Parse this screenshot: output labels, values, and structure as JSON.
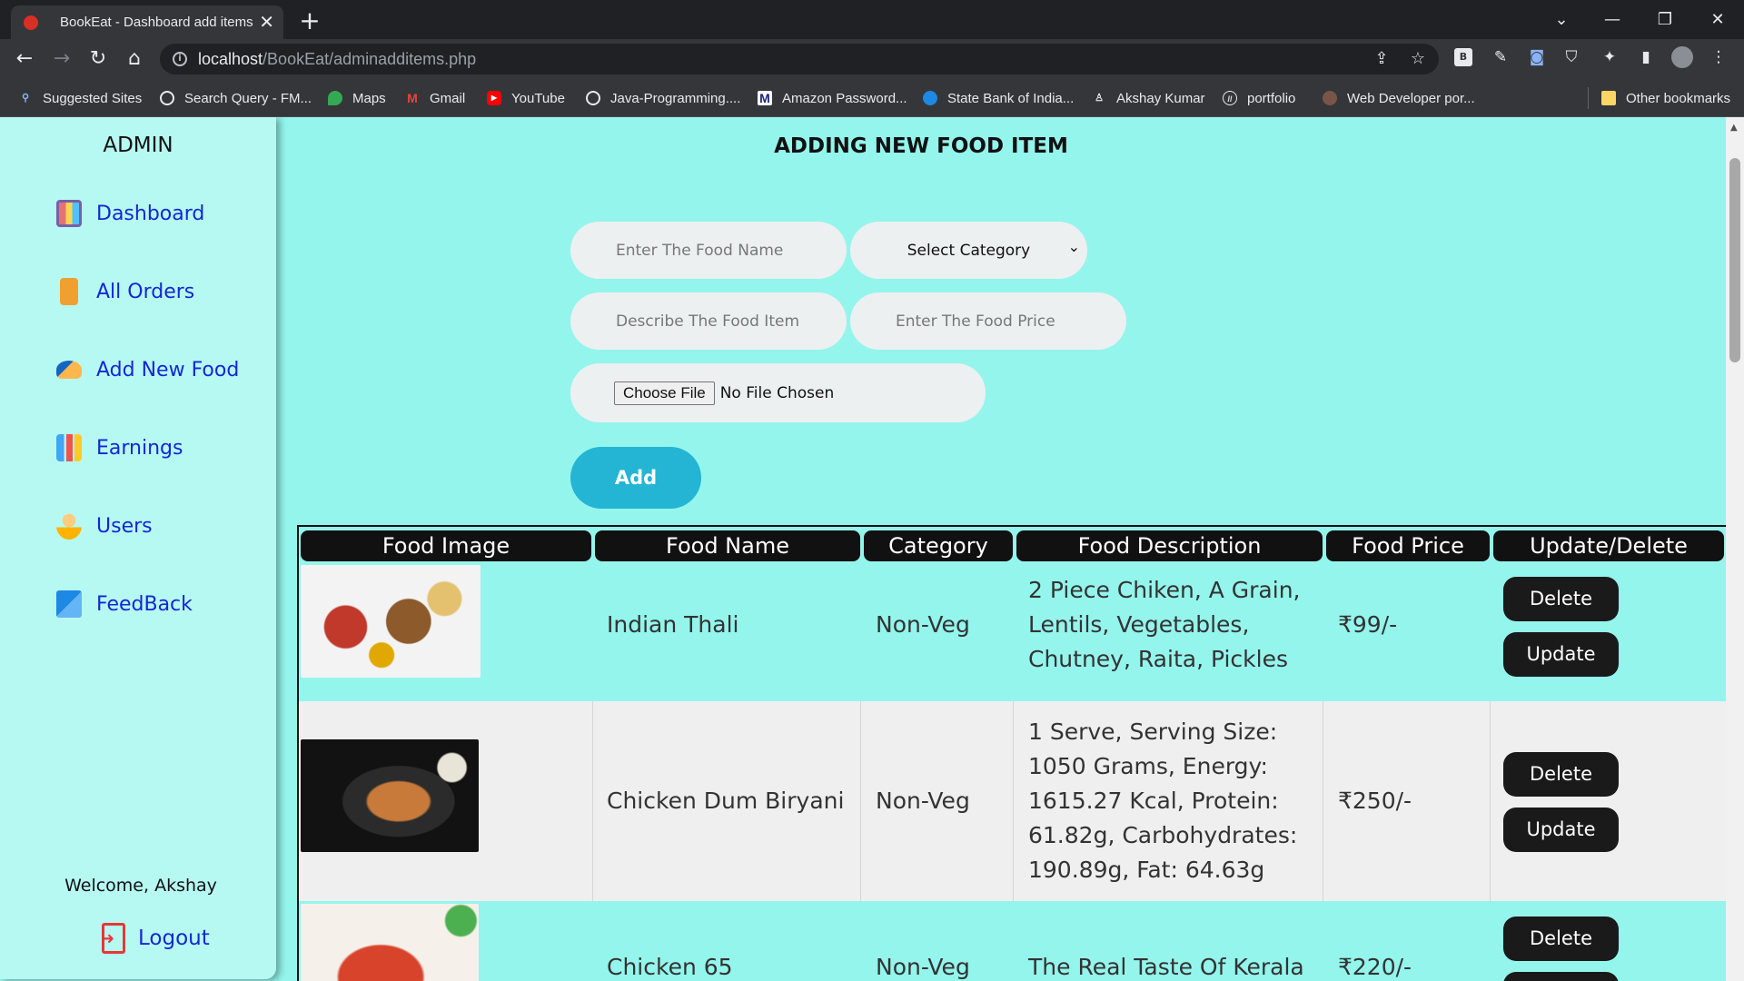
{
  "browser": {
    "tab_title": "BookEat - Dashboard add items",
    "url_host": "localhost",
    "url_path": "/BookEat/adminadditems.php",
    "bookmarks": [
      "Suggested Sites",
      "Search Query - FM...",
      "Maps",
      "Gmail",
      "YouTube",
      "Java-Programming....",
      "Amazon Password...",
      "State Bank of India...",
      "Akshay Kumar",
      "portfolio",
      "Web Developer por...",
      "Other bookmarks"
    ]
  },
  "sidebar": {
    "title": "ADMIN",
    "items": [
      {
        "label": "Dashboard",
        "icon": "dashboard-icon"
      },
      {
        "label": "All Orders",
        "icon": "orders-icon"
      },
      {
        "label": "Add New Food",
        "icon": "add-food-icon"
      },
      {
        "label": "Earnings",
        "icon": "earnings-icon"
      },
      {
        "label": "Users",
        "icon": "users-icon"
      },
      {
        "label": "FeedBack",
        "icon": "feedback-icon"
      }
    ],
    "welcome": "Welcome, Akshay",
    "logout": "Logout"
  },
  "form": {
    "heading": "ADDING NEW FOOD ITEM",
    "food_name_placeholder": "Enter The Food Name",
    "category_selected": "Select Category",
    "description_placeholder": "Describe The Food Item",
    "price_placeholder": "Enter The Food Price",
    "file_button": "Choose File",
    "file_status": "No File Chosen",
    "add_label": "Add"
  },
  "table": {
    "headers": [
      "Food Image",
      "Food Name",
      "Category",
      "Food Description",
      "Food Price",
      "Update/Delete"
    ],
    "rows": [
      {
        "name": "Indian Thali",
        "category": "Non-Veg",
        "description": [
          "2 Piece Chiken, A Grain,",
          "Lentils, Vegetables,",
          "Chutney, Raita, Pickles"
        ],
        "price": "₹99/-"
      },
      {
        "name": "Chicken Dum Biryani",
        "category": "Non-Veg",
        "description": [
          "1 Serve, Serving Size:",
          "1050 Grams, Energy:",
          "1615.27 Kcal, Protein:",
          "61.82g, Carbohydrates:",
          "190.89g, Fat: 64.63g"
        ],
        "price": "₹250/-"
      },
      {
        "name": "Chicken 65",
        "category": "Non-Veg",
        "description": [
          "The Real Taste Of Kerala"
        ],
        "price": "₹220/-"
      }
    ],
    "delete_label": "Delete",
    "update_label": "Update"
  }
}
